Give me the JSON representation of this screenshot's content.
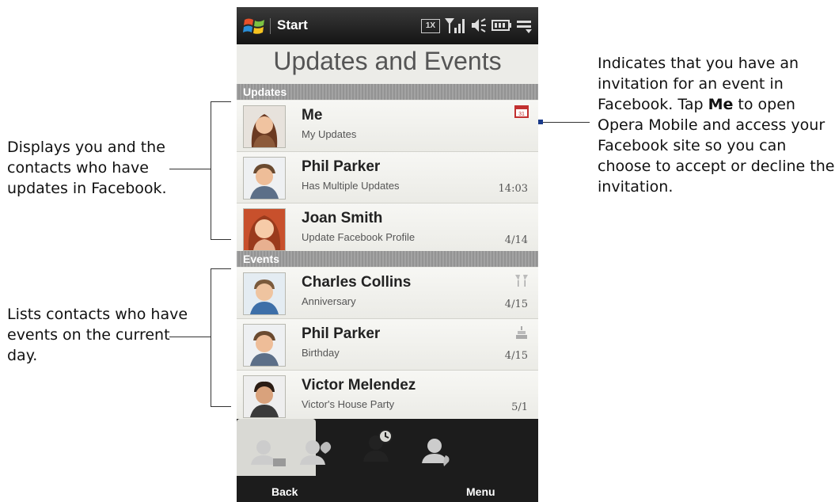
{
  "annotations": {
    "left_1": "Displays you and the contacts who have updates in Facebook.",
    "left_2": "Lists contacts who have events on the current day.",
    "right_pre": "Indicates that you have an invitation for an event in Facebook. Tap ",
    "right_bold": "Me",
    "right_post": " to open Opera Mobile and access your Facebook site so you can choose to accept or decline the invitation."
  },
  "status_bar": {
    "start_label": "Start",
    "icons": [
      "network-1x-icon",
      "signal-icon",
      "speaker-icon",
      "battery-icon",
      "connection-menu-icon"
    ]
  },
  "page_title": "Updates and Events",
  "updates": {
    "header": "Updates",
    "items": [
      {
        "name": "Me",
        "subtitle": "My Updates",
        "time": "",
        "icon": "calendar-invite-icon"
      },
      {
        "name": "Phil Parker",
        "subtitle": "Has Multiple Updates",
        "time": "14:03"
      },
      {
        "name": "Joan Smith",
        "subtitle": "Update Facebook Profile",
        "time": "4/14"
      }
    ]
  },
  "events": {
    "header": "Events",
    "items": [
      {
        "name": "Charles Collins",
        "subtitle": "Anniversary",
        "time": "4/15",
        "icon": "champagne-glasses-icon"
      },
      {
        "name": "Phil Parker",
        "subtitle": "Birthday",
        "time": "4/15",
        "icon": "birthday-cake-icon"
      },
      {
        "name": "Victor Melendez",
        "subtitle": "Victor's House Party",
        "time": "5/1"
      }
    ]
  },
  "tabs": [
    "contact-details-icon",
    "communications-icon",
    "updates-events-icon",
    "call-history-icon"
  ],
  "softkeys": {
    "left": "Back",
    "right": "Menu"
  },
  "colors": {
    "section_header": "#999999",
    "list_bg": "#ecece8",
    "status_bar": "#1c1c1c"
  }
}
